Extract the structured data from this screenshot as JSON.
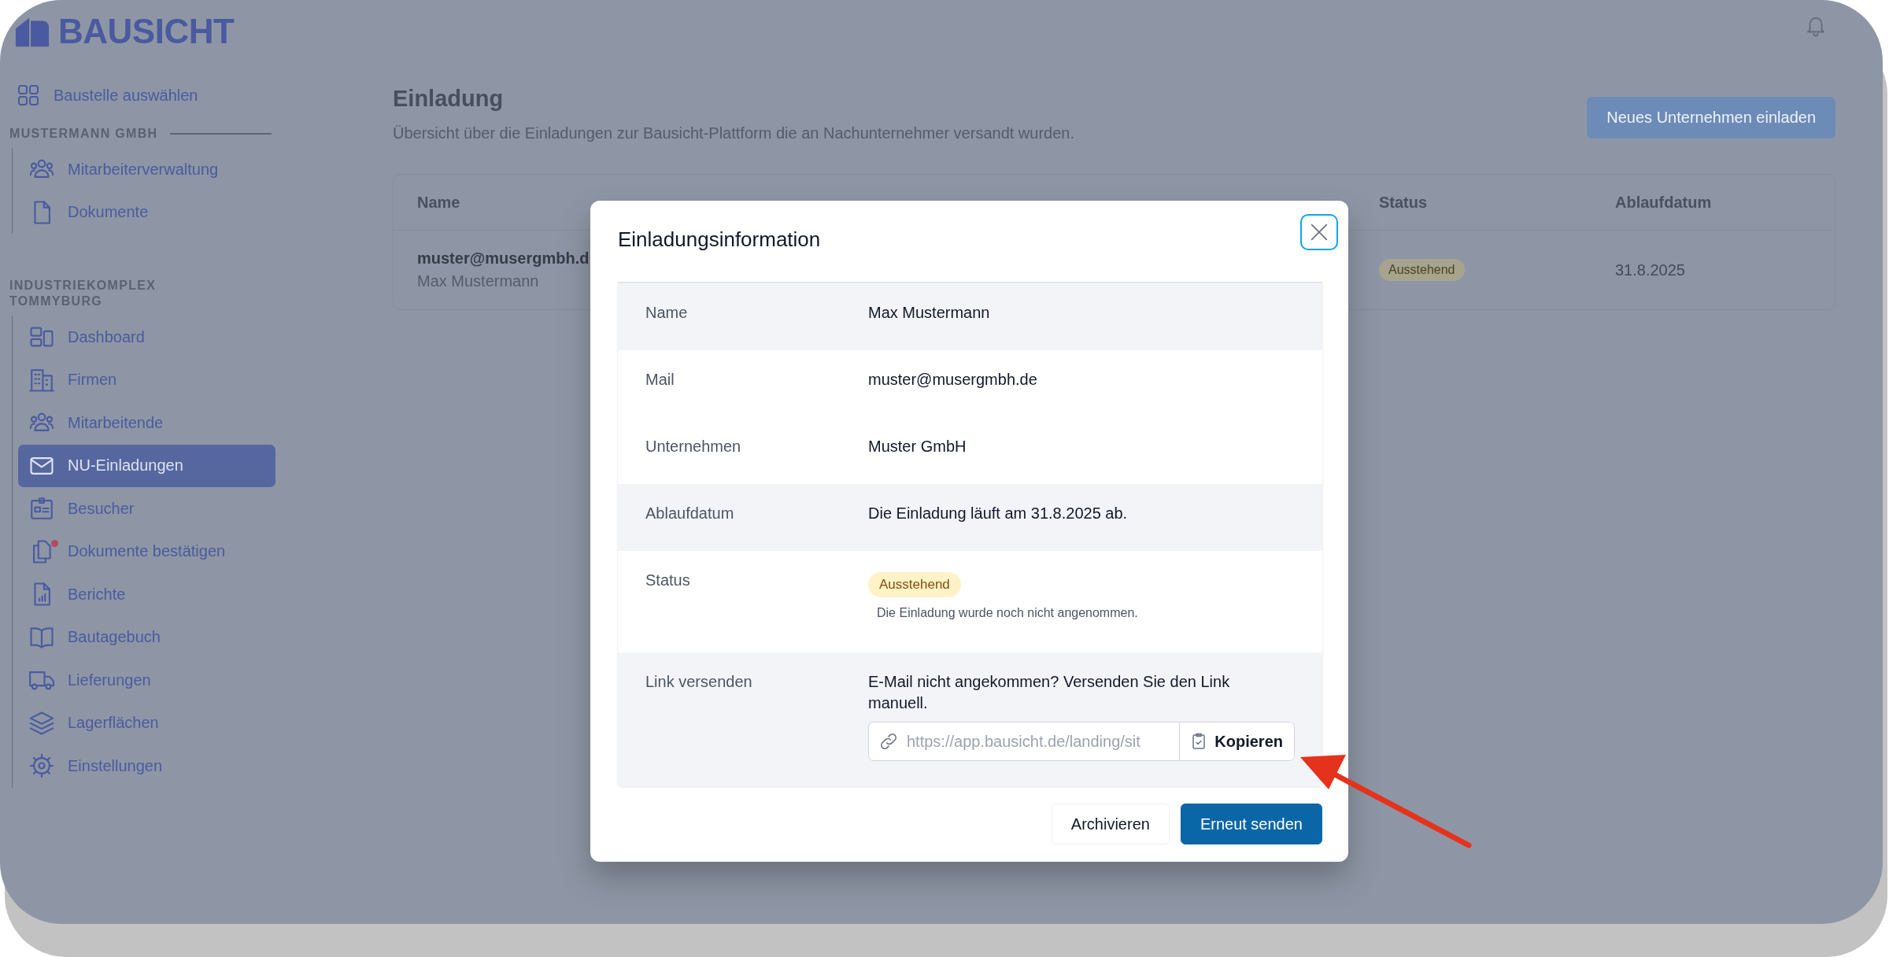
{
  "logo": {
    "text": "BAUSICHT"
  },
  "sidebar": {
    "top_item": {
      "label": "Baustelle auswählen"
    },
    "sections": [
      {
        "title": "MUSTERMANN GMBH",
        "items": [
          {
            "label": "Mitarbeiterverwaltung",
            "selected": false,
            "badge": false
          },
          {
            "label": "Dokumente",
            "selected": false,
            "badge": false
          }
        ]
      },
      {
        "title": "INDUSTRIEKOMPLEX TOMMYBURG",
        "items": [
          {
            "label": "Dashboard",
            "selected": false,
            "badge": false
          },
          {
            "label": "Firmen",
            "selected": false,
            "badge": false
          },
          {
            "label": "Mitarbeitende",
            "selected": false,
            "badge": false
          },
          {
            "label": "NU-Einladungen",
            "selected": true,
            "badge": false
          },
          {
            "label": "Besucher",
            "selected": false,
            "badge": false
          },
          {
            "label": "Dokumente bestätigen",
            "selected": false,
            "badge": true
          },
          {
            "label": "Berichte",
            "selected": false,
            "badge": false
          },
          {
            "label": "Bautagebuch",
            "selected": false,
            "badge": false
          },
          {
            "label": "Lieferungen",
            "selected": false,
            "badge": false
          },
          {
            "label": "Lagerflächen",
            "selected": false,
            "badge": false
          },
          {
            "label": "Einstellungen",
            "selected": false,
            "badge": false
          }
        ]
      }
    ]
  },
  "page": {
    "title": "Einladung",
    "subtitle": "Übersicht über die Einladungen zur Bausicht-Plattform die an Nachunternehmer versandt wurden.",
    "primary_button": "Neues Unternehmen einladen"
  },
  "table": {
    "columns": [
      {
        "label": "Name"
      },
      {
        "label": "Status"
      },
      {
        "label": "Ablaufdatum"
      }
    ],
    "rows": [
      {
        "email": "muster@musergmbh.d",
        "name": "Max Mustermann",
        "status": "Ausstehend",
        "expiry": "31.8.2025"
      }
    ]
  },
  "modal": {
    "title": "Einladungsinformation",
    "rows": [
      {
        "kind": "text",
        "label": "Name",
        "value": "Max Mustermann",
        "shaded": true
      },
      {
        "kind": "text",
        "label": "Mail",
        "value": "muster@musergmbh.de",
        "shaded": false
      },
      {
        "kind": "text",
        "label": "Unternehmen",
        "value": "Muster GmbH",
        "shaded": false
      },
      {
        "kind": "text",
        "label": "Ablaufdatum",
        "value": "Die Einladung läuft am 31.8.2025 ab.",
        "shaded": true
      },
      {
        "kind": "status",
        "label": "Status",
        "badge": "Ausstehend",
        "note": "Die Einladung wurde noch nicht angenommen.",
        "shaded": false
      },
      {
        "kind": "link",
        "label": "Link versenden",
        "text": "E-Mail nicht angekommen? Versenden Sie den Link manuell.",
        "url": "https://app.bausicht.de/landing/sit",
        "button": "Kopieren",
        "shaded": true
      }
    ],
    "buttons": [
      {
        "label": "Archivieren",
        "kind": "secondary"
      },
      {
        "label": "Erneut senden",
        "kind": "primary"
      }
    ]
  }
}
